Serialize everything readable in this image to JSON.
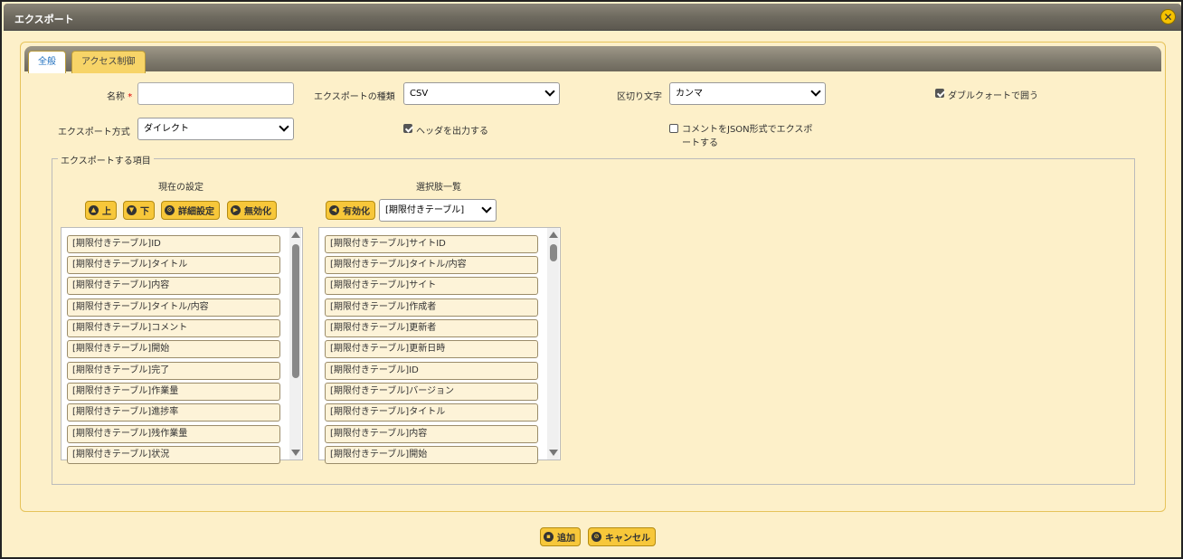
{
  "dialog": {
    "title": "エクスポート"
  },
  "tabs": [
    {
      "label": "全般"
    },
    {
      "label": "アクセス制御"
    }
  ],
  "form": {
    "name_label": "名称",
    "required_mark": "*",
    "name_value": "",
    "export_type_label": "エクスポートの種類",
    "export_type_value": "CSV",
    "delimiter_label": "区切り文字",
    "delimiter_value": "カンマ",
    "double_quote_label": "ダブルクォートで囲う",
    "double_quote_checked": true,
    "export_method_label": "エクスポート方式",
    "export_method_value": "ダイレクト",
    "output_header_label": "ヘッダを出力する",
    "output_header_checked": true,
    "json_comment_label_line1": "コメントをJSON形式でエクスポ",
    "json_comment_label_line2": "ートする",
    "json_comment_checked": false
  },
  "export_items": {
    "legend": "エクスポートする項目",
    "current": {
      "title": "現在の設定",
      "buttons": {
        "up": "上",
        "down": "下",
        "detail": "詳細設定",
        "disable": "無効化"
      },
      "items": [
        "[期限付きテーブル]ID",
        "[期限付きテーブル]タイトル",
        "[期限付きテーブル]内容",
        "[期限付きテーブル]タイトル/内容",
        "[期限付きテーブル]コメント",
        "[期限付きテーブル]開始",
        "[期限付きテーブル]完了",
        "[期限付きテーブル]作業量",
        "[期限付きテーブル]進捗率",
        "[期限付きテーブル]残作業量",
        "[期限付きテーブル]状況"
      ]
    },
    "choices": {
      "title": "選択肢一覧",
      "buttons": {
        "enable": "有効化"
      },
      "filter_value": "[期限付きテーブル]",
      "items": [
        "[期限付きテーブル]サイトID",
        "[期限付きテーブル]タイトル/内容",
        "[期限付きテーブル]サイト",
        "[期限付きテーブル]作成者",
        "[期限付きテーブル]更新者",
        "[期限付きテーブル]更新日時",
        "[期限付きテーブル]ID",
        "[期限付きテーブル]バージョン",
        "[期限付きテーブル]タイトル",
        "[期限付きテーブル]内容",
        "[期限付きテーブル]開始"
      ]
    }
  },
  "footer": {
    "add_label": "追加",
    "cancel_label": "キャンセル"
  }
}
